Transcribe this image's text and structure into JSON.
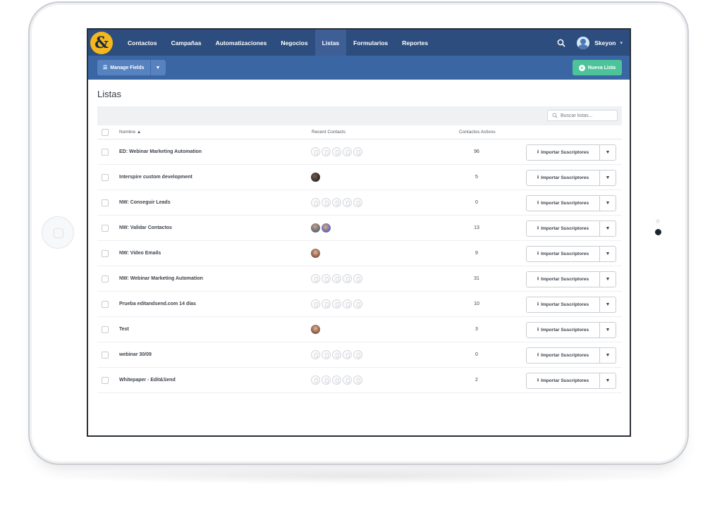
{
  "nav": {
    "logo": "&",
    "items": [
      {
        "label": "Contactos"
      },
      {
        "label": "Campañas"
      },
      {
        "label": "Automatizaciones"
      },
      {
        "label": "Negocios"
      },
      {
        "label": "Listas",
        "active": true
      },
      {
        "label": "Formularios"
      },
      {
        "label": "Reportes"
      }
    ],
    "user_name": "Skeyon"
  },
  "toolbar": {
    "manage_fields_label": "Manage Fields",
    "new_list_label": "Nueva Lista"
  },
  "page": {
    "title": "Listas",
    "search_placeholder": "Buscar listas..."
  },
  "table": {
    "headers": {
      "name": "Nombre ▲",
      "recent": "Recent Contacts",
      "active": "Contactos Activos"
    },
    "import_label": "Importar Suscriptores",
    "rows": [
      {
        "name": "ED: Webinar Marketing Automation",
        "active": "96",
        "recent": [
          "placeholder",
          "placeholder",
          "placeholder",
          "placeholder",
          "placeholder"
        ]
      },
      {
        "name": "Interspire custom development",
        "active": "5",
        "recent": [
          "avatar-dark"
        ]
      },
      {
        "name": "NW: Conseguir Leads",
        "active": "0",
        "recent": [
          "placeholder",
          "placeholder",
          "placeholder",
          "placeholder",
          "placeholder"
        ]
      },
      {
        "name": "NW: Validar Contactos",
        "active": "13",
        "recent": [
          "avatar-grey",
          "avatar-purple"
        ]
      },
      {
        "name": "NW: Video Emails",
        "active": "9",
        "recent": [
          "avatar-face"
        ]
      },
      {
        "name": "NW: Webinar Marketing Automation",
        "active": "31",
        "recent": [
          "placeholder",
          "placeholder",
          "placeholder",
          "placeholder",
          "placeholder"
        ]
      },
      {
        "name": "Prueba editandsend.com 14 días",
        "active": "10",
        "recent": [
          "placeholder",
          "placeholder",
          "placeholder",
          "placeholder",
          "placeholder"
        ]
      },
      {
        "name": "Test",
        "active": "3",
        "recent": [
          "avatar-face"
        ]
      },
      {
        "name": "webinar 30/09",
        "active": "0",
        "recent": [
          "placeholder",
          "placeholder",
          "placeholder",
          "placeholder",
          "placeholder"
        ]
      },
      {
        "name": "Whitepaper - Edit&Send",
        "active": "2",
        "recent": [
          "placeholder",
          "placeholder",
          "placeholder",
          "placeholder",
          "placeholder"
        ]
      }
    ]
  },
  "colors": {
    "nav_bg": "#2d4d7e",
    "toolbar_bg": "#3a66a3",
    "logo": "#f5b81c",
    "new_list_button": "#4dc39a"
  }
}
